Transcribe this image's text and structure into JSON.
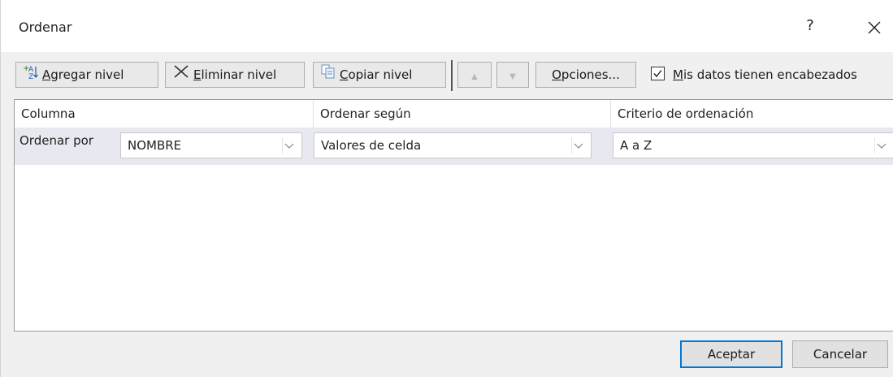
{
  "window": {
    "title": "Ordenar",
    "help": "?",
    "close": "✕"
  },
  "toolbar": {
    "add_level": {
      "accel": "A",
      "rest": "gregar nivel"
    },
    "delete_level": {
      "accel": "E",
      "rest": "liminar nivel"
    },
    "copy_level": {
      "accel": "C",
      "rest": "opiar nivel"
    },
    "move_up": "▲",
    "move_down": "▼",
    "options": {
      "accel": "O",
      "rest": "pciones..."
    },
    "headers_checkbox": {
      "accel": "M",
      "rest": "is datos tienen encabezados",
      "checked": true
    }
  },
  "grid": {
    "headers": [
      "Columna",
      "Ordenar según",
      "Criterio de ordenación"
    ],
    "rows": [
      {
        "label": "Ordenar por",
        "column": "NOMBRE",
        "sort_on": "Valores de celda",
        "order": "A a Z"
      }
    ]
  },
  "footer": {
    "ok": "Aceptar",
    "cancel": "Cancelar"
  },
  "colors": {
    "selected_row": "#e8e8f0",
    "default_button_border": "#0078d7"
  }
}
